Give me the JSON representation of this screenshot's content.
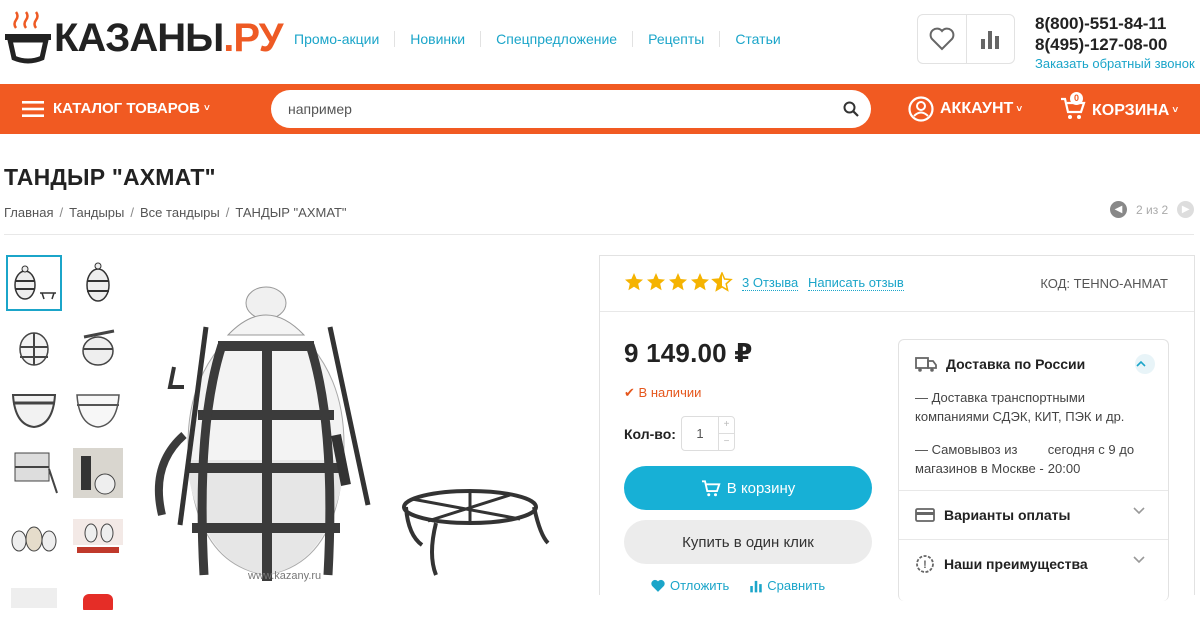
{
  "logo": {
    "main": "КАЗАНЫ",
    "suffix": ".РУ"
  },
  "topnav": [
    "Промо-акции",
    "Новинки",
    "Спецпредложение",
    "Рецепты",
    "Статьи"
  ],
  "contacts": {
    "phone1": "8(800)-551-84-11",
    "phone2": "8(495)-127-08-00",
    "callback": "Заказать обратный звонок"
  },
  "menubar": {
    "catalog": "КАТАЛОГ ТОВАРОВ",
    "search_placeholder": "например",
    "account": "АККАУНТ",
    "cart": "КОРЗИНА",
    "cart_count": "0"
  },
  "product": {
    "title": "ТАНДЫР \"АХМАТ\"",
    "breadcrumbs": [
      "Главная",
      "Тандыры",
      "Все тандыры",
      "ТАНДЫР \"АХМАТ\""
    ],
    "pager": "2 из 2",
    "rating": 4.5,
    "reviews": "3 Отзыва",
    "write_review": "Написать отзыв",
    "code": "КОД: TEHNO-AHMAT",
    "price": "9 149.00 ₽",
    "availability": "В наличии",
    "qty_label": "Кол-во:",
    "qty": "1",
    "add_to_cart": "В корзину",
    "one_click": "Купить в один клик",
    "postpone": "Отложить",
    "compare": "Сравнить",
    "watermark": "www.kazany.ru"
  },
  "side": {
    "delivery_title": "Доставка по России",
    "delivery_text": "— Доставка транспортными компаниями СДЭК, КИТ, ПЭК и др.",
    "pickup_left": "— Самовывоз из магазинов в Москве -",
    "pickup_right": "сегодня с 9 до 20:00",
    "payment_title": "Варианты оплаты",
    "advantages_title": "Наши преимущества"
  },
  "colors": {
    "accent": "#f15a22",
    "link": "#1ba5c9",
    "button": "#17b0d6",
    "star": "#f5b301"
  }
}
